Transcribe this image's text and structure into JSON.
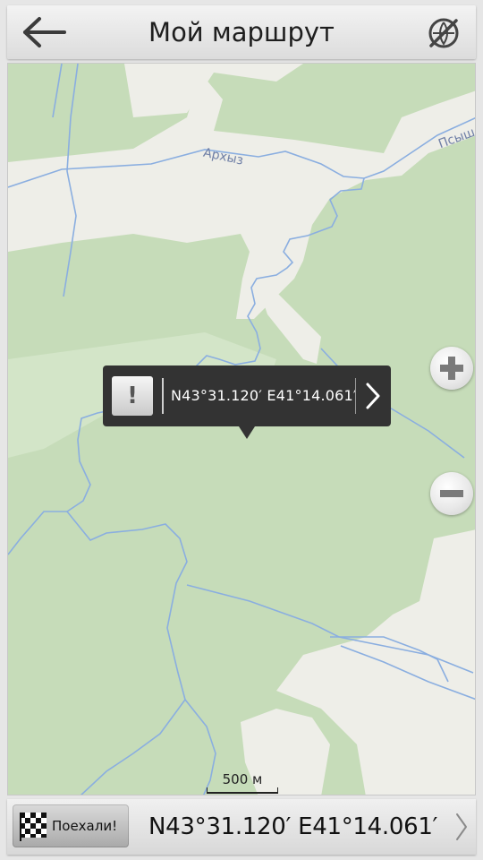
{
  "header": {
    "title": "Мой маршрут",
    "back_icon": "arrow-left-icon",
    "gps_icon": "gps-off-icon"
  },
  "map": {
    "road_label_1": "Архыз",
    "road_label_2": "Псыш",
    "scale_label": "500 м",
    "colors": {
      "forest": "#c6dcb9",
      "open_land": "#eeeee8",
      "water": "#8aaee0",
      "popup": "#333333"
    }
  },
  "popup": {
    "warning_glyph": "!",
    "coords": "N43°31.120′ E41°14.061′",
    "arrow_icon": "chevron-right-icon"
  },
  "zoom": {
    "in_icon": "zoom-in-icon",
    "out_icon": "zoom-out-icon"
  },
  "bottom_bar": {
    "go_label": "Поехали!",
    "flag_icon": "checkered-flag-icon",
    "coords": "N43°31.120′ E41°14.061′",
    "arrow_icon": "chevron-right-icon"
  }
}
